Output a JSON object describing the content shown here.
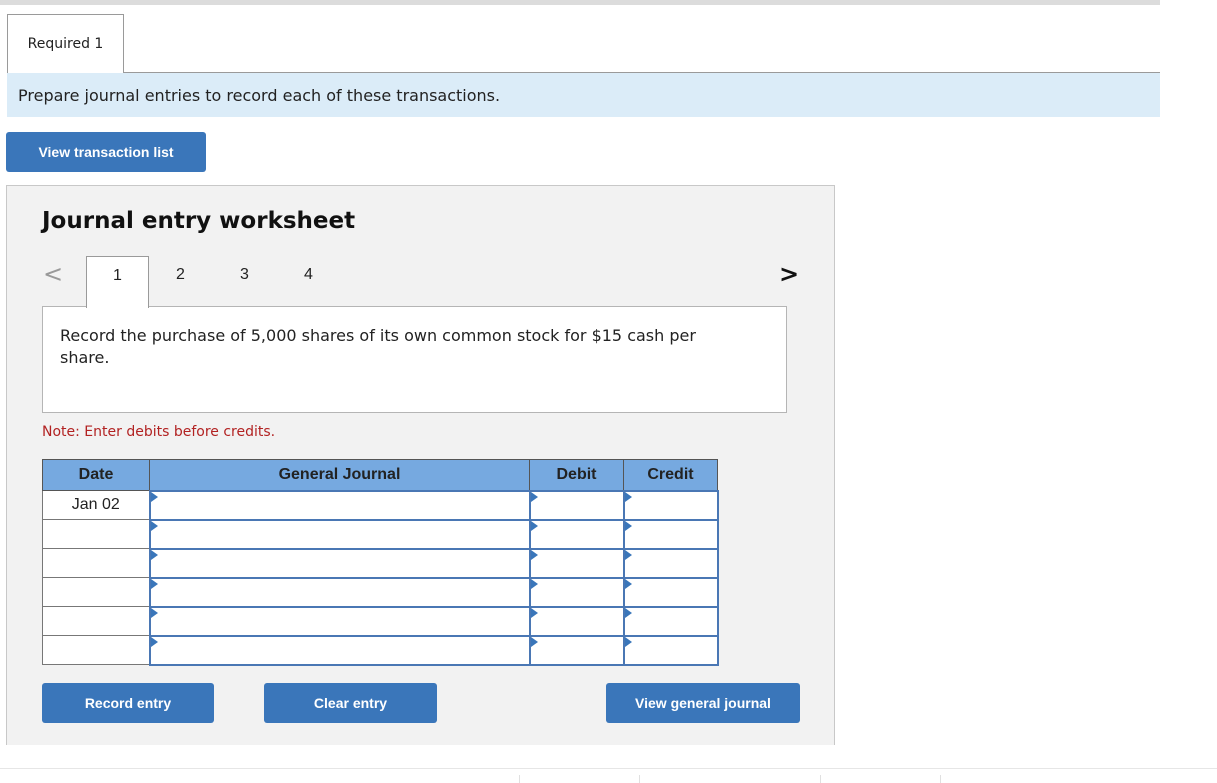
{
  "tabs": {
    "required_1": "Required 1"
  },
  "instruction": "Prepare journal entries to record each of these transactions.",
  "buttons": {
    "view_transaction_list": "View transaction list",
    "record_entry": "Record entry",
    "clear_entry": "Clear entry",
    "view_general_journal": "View general journal"
  },
  "worksheet": {
    "title": "Journal entry worksheet",
    "nav_prev": "<",
    "nav_next": ">",
    "pages": [
      "1",
      "2",
      "3",
      "4"
    ],
    "active_page": "1",
    "description": "Record the purchase of 5,000 shares of its own common stock for $15 cash per share.",
    "note": "Note: Enter debits before credits."
  },
  "journal": {
    "headers": {
      "date": "Date",
      "general_journal": "General Journal",
      "debit": "Debit",
      "credit": "Credit"
    },
    "rows": [
      {
        "date": "Jan 02",
        "account": "",
        "debit": "",
        "credit": ""
      },
      {
        "date": "",
        "account": "",
        "debit": "",
        "credit": ""
      },
      {
        "date": "",
        "account": "",
        "debit": "",
        "credit": ""
      },
      {
        "date": "",
        "account": "",
        "debit": "",
        "credit": ""
      },
      {
        "date": "",
        "account": "",
        "debit": "",
        "credit": ""
      },
      {
        "date": "",
        "account": "",
        "debit": "",
        "credit": ""
      }
    ]
  },
  "colors": {
    "primary_button": "#3a76ba",
    "table_header": "#76a9e0",
    "instruction_bg": "#dbecf8",
    "note_text": "#b22222"
  }
}
